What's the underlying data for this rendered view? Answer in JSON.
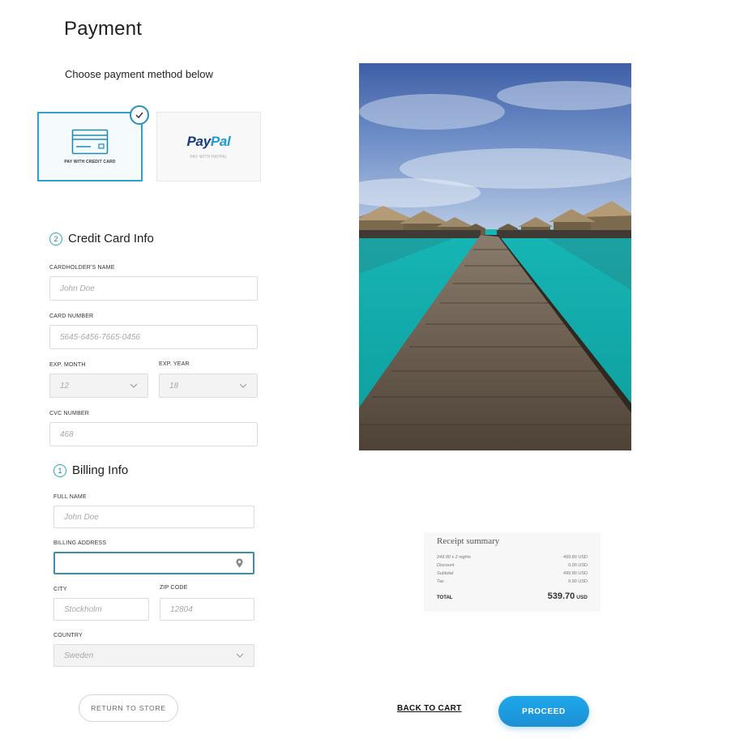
{
  "page": {
    "title": "Payment",
    "subtitle": "Choose payment method below"
  },
  "payment_methods": [
    {
      "caption": "PAY WITH CREDIT CARD",
      "icon": "credit-card-icon",
      "selected": true
    },
    {
      "caption": "PAY WITH PAYPAL",
      "logo_left": "Pay",
      "logo_right": "Pal",
      "selected": false
    }
  ],
  "credit_card": {
    "step": "2",
    "title": "Credit Card Info",
    "cardholder_label": "CARDHOLDER'S NAME",
    "cardholder_placeholder": "John Doe",
    "card_number_label": "CARD NUMBER",
    "card_number_placeholder": "5645-6456-7665-0456",
    "exp_month_label": "EXP. MONTH",
    "exp_month_value": "12",
    "exp_year_label": "EXP. YEAR",
    "exp_year_value": "18",
    "cvc_label": "CVC NUMBER",
    "cvc_placeholder": "468"
  },
  "billing": {
    "step": "1",
    "title": "Billing Info",
    "full_name_label": "FULL NAME",
    "full_name_placeholder": "John Doe",
    "address_label": "BILLING ADDRESS",
    "address_value": "",
    "city_label": "CITY",
    "city_placeholder": "Stockholm",
    "zip_label": "ZIP CODE",
    "zip_placeholder": "12804",
    "country_label": "COUNTRY",
    "country_value": "Sweden"
  },
  "receipt": {
    "title": "Receipt summary",
    "rows": [
      {
        "label": "249.90 x 2 nights",
        "value": "499.80 USD"
      },
      {
        "label": "Discount",
        "value": "0.00 USD"
      },
      {
        "label": "Subtotal",
        "value": "499.80 USD"
      },
      {
        "label": "Tax",
        "value": "9.90 USD"
      }
    ],
    "total_label": "TOTAL",
    "total_amount": "539.70",
    "total_currency": "USD"
  },
  "actions": {
    "return_label": "RETURN TO STORE",
    "back_label": "BACK TO CART",
    "proceed_label": "PROCEED"
  },
  "colors": {
    "accent": "#2da3c9",
    "primary_button": "#1c98dd",
    "paypal_dark": "#173a84",
    "paypal_light": "#1f9ad7"
  }
}
